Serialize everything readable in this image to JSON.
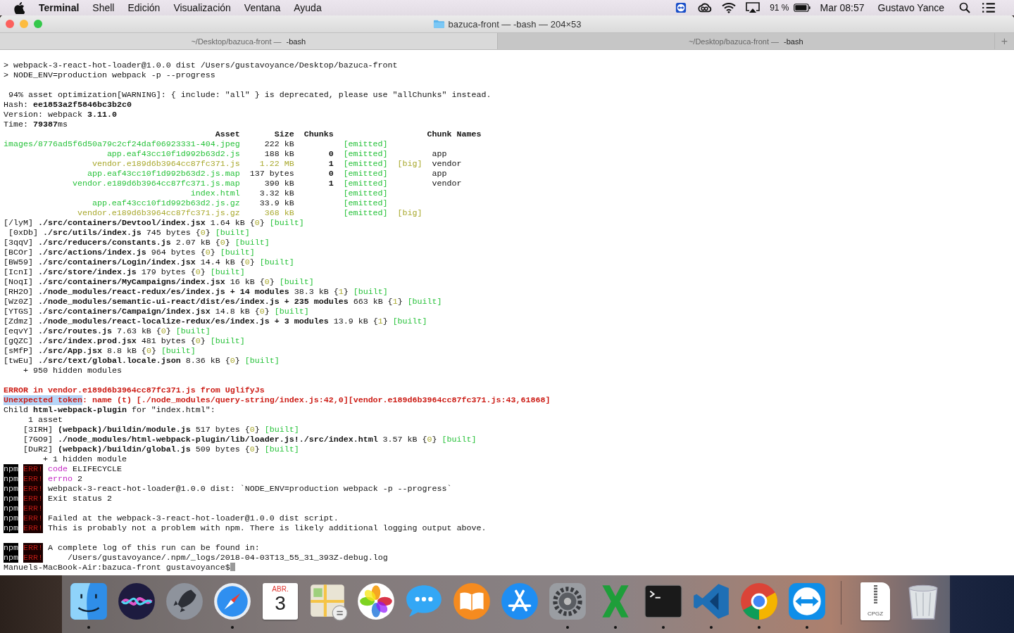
{
  "menu_bar": {
    "app": "Terminal",
    "items": [
      "Shell",
      "Edición",
      "Visualización",
      "Ventana",
      "Ayuda"
    ],
    "battery_percent": "91 %",
    "clock": "Mar 08:57",
    "user": "Gustavo Yance"
  },
  "window": {
    "title": "bazuca-front — -bash — 204×53",
    "tabs": [
      {
        "path": "~/Desktop/bazuca-front —",
        "process": "-bash",
        "selected": true
      },
      {
        "path": "~/Desktop/bazuca-front —",
        "process": "-bash",
        "selected": false
      }
    ],
    "new_tab": "+"
  },
  "terminal": {
    "lines": [
      {
        "kind": "text",
        "segments": [
          {
            "text": "> webpack-3-react-hot-loader@1.0.0 dist /Users/gustavoyance/Desktop/bazuca-front",
            "kind": "plain"
          }
        ]
      },
      {
        "kind": "text",
        "segments": [
          {
            "text": "> NODE_ENV=production webpack -p --progress",
            "kind": "plain"
          }
        ]
      },
      {
        "kind": "blank"
      },
      {
        "kind": "text",
        "segments": [
          {
            "text": " 94% asset optimization[WARNING]: { include: \"all\" } is deprecated, please use \"allChunks\" instead.",
            "kind": "plain"
          }
        ]
      },
      {
        "kind": "text",
        "segments": [
          {
            "text": "Hash: **ee1853a2f5846bc3b2c0**",
            "kind": "plain"
          }
        ]
      },
      {
        "kind": "text",
        "segments": [
          {
            "text": "Version: webpack **3.11.0**",
            "kind": "plain"
          }
        ]
      },
      {
        "kind": "text",
        "segments": [
          {
            "text": "Time: **79387**ms",
            "kind": "plain"
          }
        ]
      },
      {
        "kind": "asset_header",
        "asset": "Asset",
        "size": "Size",
        "chunks": "Chunks",
        "chunk_names": "Chunk Names"
      },
      {
        "kind": "asset_row",
        "oversized": false,
        "asset": "images/8776ad5f6d50a79c2cf24daf06923331-404.jpeg",
        "size": "222 kB",
        "emitted": "[emitted]"
      },
      {
        "kind": "asset_row",
        "oversized": false,
        "asset": "app.eaf43cc10f1d992b63d2.js",
        "size": "188 kB",
        "chunk": "0",
        "emitted": "[emitted]",
        "chunk_name": "app"
      },
      {
        "kind": "asset_row",
        "oversized": true,
        "asset": "vendor.e189d6b3964cc87fc371.js",
        "size": "1.22 MB",
        "chunk": "1",
        "emitted": "[emitted]",
        "flag": "[big]",
        "chunk_name": "vendor"
      },
      {
        "kind": "asset_row",
        "oversized": false,
        "asset": "app.eaf43cc10f1d992b63d2.js.map",
        "size": "137 bytes",
        "chunk": "0",
        "emitted": "[emitted]",
        "chunk_name": "app"
      },
      {
        "kind": "asset_row",
        "oversized": false,
        "asset": "vendor.e189d6b3964cc87fc371.js.map",
        "size": "390 kB",
        "chunk": "1",
        "emitted": "[emitted]",
        "chunk_name": "vendor"
      },
      {
        "kind": "asset_row",
        "oversized": false,
        "asset": "index.html",
        "size": "3.32 kB",
        "emitted": "[emitted]"
      },
      {
        "kind": "asset_row",
        "oversized": false,
        "asset": "app.eaf43cc10f1d992b63d2.js.gz",
        "size": "33.9 kB",
        "emitted": "[emitted]"
      },
      {
        "kind": "asset_row",
        "oversized": true,
        "asset": "vendor.e189d6b3964cc87fc371.js.gz",
        "size": "368 kB",
        "emitted": "[emitted]",
        "flag": "[big]"
      },
      {
        "kind": "text",
        "segments": [
          {
            "text": "[/lyM] **./src/containers/Devtool/index.jsx** 1.64 kB {",
            "kind": "plain"
          },
          {
            "text": "0",
            "kind": "yellow"
          },
          {
            "text": "} ",
            "kind": "plain"
          },
          {
            "text": "[built]",
            "kind": "green"
          }
        ]
      },
      {
        "kind": "text",
        "segments": [
          {
            "text": " [0xDb] **./src/utils/index.js** 745 bytes {",
            "kind": "plain"
          },
          {
            "text": "0",
            "kind": "yellow"
          },
          {
            "text": "} ",
            "kind": "plain"
          },
          {
            "text": "[built]",
            "kind": "green"
          }
        ]
      },
      {
        "kind": "text",
        "segments": [
          {
            "text": "[3qqV] **./src/reducers/constants.js** 2.07 kB {",
            "kind": "plain"
          },
          {
            "text": "0",
            "kind": "yellow"
          },
          {
            "text": "} ",
            "kind": "plain"
          },
          {
            "text": "[built]",
            "kind": "green"
          }
        ]
      },
      {
        "kind": "text",
        "segments": [
          {
            "text": "[BCOr] **./src/actions/index.js** 964 bytes {",
            "kind": "plain"
          },
          {
            "text": "0",
            "kind": "yellow"
          },
          {
            "text": "} ",
            "kind": "plain"
          },
          {
            "text": "[built]",
            "kind": "green"
          }
        ]
      },
      {
        "kind": "text",
        "segments": [
          {
            "text": "[BW59] **./src/containers/Login/index.jsx** 14.4 kB {",
            "kind": "plain"
          },
          {
            "text": "0",
            "kind": "yellow"
          },
          {
            "text": "} ",
            "kind": "plain"
          },
          {
            "text": "[built]",
            "kind": "green"
          }
        ]
      },
      {
        "kind": "text",
        "segments": [
          {
            "text": "[IcnI] **./src/store/index.js** 179 bytes {",
            "kind": "plain"
          },
          {
            "text": "0",
            "kind": "yellow"
          },
          {
            "text": "} ",
            "kind": "plain"
          },
          {
            "text": "[built]",
            "kind": "green"
          }
        ]
      },
      {
        "kind": "text",
        "segments": [
          {
            "text": "[NoqI] **./src/containers/MyCampaigns/index.jsx** 16 kB {",
            "kind": "plain"
          },
          {
            "text": "0",
            "kind": "yellow"
          },
          {
            "text": "} ",
            "kind": "plain"
          },
          {
            "text": "[built]",
            "kind": "green"
          }
        ]
      },
      {
        "kind": "text",
        "segments": [
          {
            "text": "[RH2O] **./node_modules/react-redux/es/index.js + 14 modules** 38.3 kB {",
            "kind": "plain"
          },
          {
            "text": "1",
            "kind": "yellow"
          },
          {
            "text": "} ",
            "kind": "plain"
          },
          {
            "text": "[built]",
            "kind": "green"
          }
        ]
      },
      {
        "kind": "text",
        "segments": [
          {
            "text": "[Wz0Z] **./node_modules/semantic-ui-react/dist/es/index.js + 235 modules** 663 kB {",
            "kind": "plain"
          },
          {
            "text": "1",
            "kind": "yellow"
          },
          {
            "text": "} ",
            "kind": "plain"
          },
          {
            "text": "[built]",
            "kind": "green"
          }
        ]
      },
      {
        "kind": "text",
        "segments": [
          {
            "text": "[YTGS] **./src/containers/Campaign/index.jsx** 14.8 kB {",
            "kind": "plain"
          },
          {
            "text": "0",
            "kind": "yellow"
          },
          {
            "text": "} ",
            "kind": "plain"
          },
          {
            "text": "[built]",
            "kind": "green"
          }
        ]
      },
      {
        "kind": "text",
        "segments": [
          {
            "text": "[Zdmz] **./node_modules/react-localize-redux/es/index.js + 3 modules** 13.9 kB {",
            "kind": "plain"
          },
          {
            "text": "1",
            "kind": "yellow"
          },
          {
            "text": "} ",
            "kind": "plain"
          },
          {
            "text": "[built]",
            "kind": "green"
          }
        ]
      },
      {
        "kind": "text",
        "segments": [
          {
            "text": "[eqvY] **./src/routes.js** 7.63 kB {",
            "kind": "plain"
          },
          {
            "text": "0",
            "kind": "yellow"
          },
          {
            "text": "} ",
            "kind": "plain"
          },
          {
            "text": "[built]",
            "kind": "green"
          }
        ]
      },
      {
        "kind": "text",
        "segments": [
          {
            "text": "[gQZC] **./src/index.prod.jsx** 481 bytes {",
            "kind": "plain"
          },
          {
            "text": "0",
            "kind": "yellow"
          },
          {
            "text": "} ",
            "kind": "plain"
          },
          {
            "text": "[built]",
            "kind": "green"
          }
        ]
      },
      {
        "kind": "text",
        "segments": [
          {
            "text": "[sMfP] **./src/App.jsx** 8.8 kB {",
            "kind": "plain"
          },
          {
            "text": "0",
            "kind": "yellow"
          },
          {
            "text": "} ",
            "kind": "plain"
          },
          {
            "text": "[built]",
            "kind": "green"
          }
        ]
      },
      {
        "kind": "text",
        "segments": [
          {
            "text": "[twEu] **./src/text/global.locale.json** 8.36 kB {",
            "kind": "plain"
          },
          {
            "text": "0",
            "kind": "yellow"
          },
          {
            "text": "} ",
            "kind": "plain"
          },
          {
            "text": "[built]",
            "kind": "green"
          }
        ]
      },
      {
        "kind": "text",
        "segments": [
          {
            "text": "    + 950 hidden modules",
            "kind": "plain"
          }
        ]
      },
      {
        "kind": "blank"
      },
      {
        "kind": "text",
        "segments": [
          {
            "text": "ERROR in vendor.e189d6b3964cc87fc371.js from UglifyJs",
            "kind": "error"
          }
        ]
      },
      {
        "kind": "text",
        "segments": [
          {
            "text": "Unexpected token",
            "kind": "selection"
          },
          {
            "text": ": name (t) [./node_modules/query-string/index.js:42,0][vendor.e189d6b3964cc87fc371.js:43,61868]",
            "kind": "error"
          }
        ]
      },
      {
        "kind": "text",
        "segments": [
          {
            "text": "Child **html-webpack-plugin** for \"index.html\":",
            "kind": "plain"
          }
        ]
      },
      {
        "kind": "text",
        "segments": [
          {
            "text": "     1 asset",
            "kind": "plain"
          }
        ]
      },
      {
        "kind": "text",
        "segments": [
          {
            "text": "    [3IRH] **(webpack)/buildin/module.js** 517 bytes {",
            "kind": "plain"
          },
          {
            "text": "0",
            "kind": "yellow"
          },
          {
            "text": "} ",
            "kind": "plain"
          },
          {
            "text": "[built]",
            "kind": "green"
          }
        ]
      },
      {
        "kind": "text",
        "segments": [
          {
            "text": "    [7GO9] **./node_modules/html-webpack-plugin/lib/loader.js!./src/index.html** 3.57 kB {",
            "kind": "plain"
          },
          {
            "text": "0",
            "kind": "yellow"
          },
          {
            "text": "} ",
            "kind": "plain"
          },
          {
            "text": "[built]",
            "kind": "green"
          }
        ]
      },
      {
        "kind": "text",
        "segments": [
          {
            "text": "    [DuR2] **(webpack)/buildin/global.js** 509 bytes {",
            "kind": "plain"
          },
          {
            "text": "0",
            "kind": "yellow"
          },
          {
            "text": "} ",
            "kind": "plain"
          },
          {
            "text": "[built]",
            "kind": "green"
          }
        ]
      },
      {
        "kind": "text",
        "segments": [
          {
            "text": "        + 1 hidden module",
            "kind": "plain"
          }
        ]
      },
      {
        "kind": "npm",
        "badge": "npm",
        "tag": "ERR!",
        "segments": [
          {
            "text": "code",
            "kind": "magenta"
          },
          {
            "text": " ELIFECYCLE",
            "kind": "plain"
          }
        ]
      },
      {
        "kind": "npm",
        "badge": "npm",
        "tag": "ERR!",
        "segments": [
          {
            "text": "errno",
            "kind": "magenta"
          },
          {
            "text": " 2",
            "kind": "plain"
          }
        ]
      },
      {
        "kind": "npm",
        "badge": "npm",
        "tag": "ERR!",
        "segments": [
          {
            "text": "webpack-3-react-hot-loader@1.0.0 dist: `NODE_ENV=production webpack -p --progress`",
            "kind": "plain"
          }
        ]
      },
      {
        "kind": "npm",
        "badge": "npm",
        "tag": "ERR!",
        "segments": [
          {
            "text": "Exit status 2",
            "kind": "plain"
          }
        ]
      },
      {
        "kind": "npm",
        "badge": "npm",
        "tag": "ERR!"
      },
      {
        "kind": "npm",
        "badge": "npm",
        "tag": "ERR!",
        "segments": [
          {
            "text": "Failed at the webpack-3-react-hot-loader@1.0.0 dist script.",
            "kind": "plain"
          }
        ]
      },
      {
        "kind": "npm",
        "badge": "npm",
        "tag": "ERR!",
        "segments": [
          {
            "text": "This is probably not a problem with npm. There is likely additional logging output above.",
            "kind": "plain"
          }
        ]
      },
      {
        "kind": "blank"
      },
      {
        "kind": "npm",
        "badge": "npm",
        "tag": "ERR!",
        "segments": [
          {
            "text": "A complete log of this run can be found in:",
            "kind": "plain"
          }
        ]
      },
      {
        "kind": "npm",
        "badge": "npm",
        "tag": "ERR!",
        "segments": [
          {
            "text": "    /Users/gustavoyance/.npm/_logs/2018-04-03T13_55_31_393Z-debug.log",
            "kind": "plain"
          }
        ]
      },
      {
        "kind": "prompt",
        "text": "Manuels-MacBook-Air:bazuca-front gustavoyance$"
      }
    ]
  },
  "dock": {
    "apps": [
      {
        "kind": "finder",
        "running": true
      },
      {
        "kind": "siri",
        "running": false
      },
      {
        "kind": "launchpad",
        "running": false
      },
      {
        "kind": "safari",
        "running": true
      },
      {
        "kind": "calendar",
        "running": false,
        "month": "ABR.",
        "day": "3"
      },
      {
        "kind": "maps",
        "running": false
      },
      {
        "kind": "photos",
        "running": false
      },
      {
        "kind": "messages",
        "running": false
      },
      {
        "kind": "books",
        "running": false
      },
      {
        "kind": "store",
        "running": false
      },
      {
        "kind": "settings",
        "running": true
      },
      {
        "kind": "spreadsheet",
        "running": true
      },
      {
        "kind": "terminal",
        "running": true
      },
      {
        "kind": "editor",
        "running": true
      },
      {
        "kind": "browser",
        "running": true
      },
      {
        "kind": "remote",
        "running": true
      }
    ],
    "stack": [
      {
        "kind": "archive",
        "label": "CPGZ"
      },
      {
        "kind": "trash"
      }
    ]
  }
}
